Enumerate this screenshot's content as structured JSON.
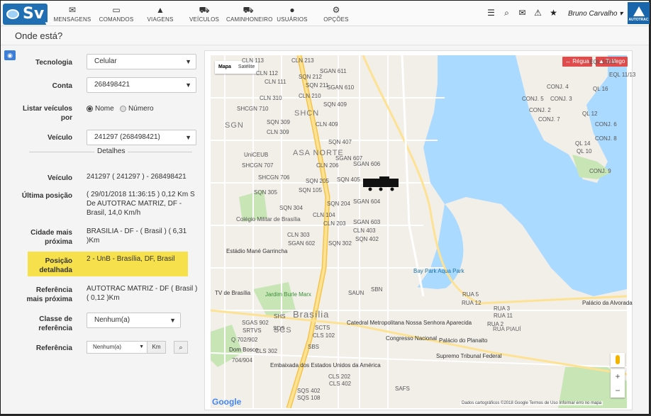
{
  "app": {
    "logo_text": "Sv",
    "logo_caret": "▼",
    "page_title": "Onde está?",
    "user_name": "Bruno Carvalho ▾",
    "brand_text": "AUTOTRAC"
  },
  "nav": [
    {
      "label": "MENSAGENS",
      "icon": "envelope-icon",
      "glyph": "✉"
    },
    {
      "label": "COMANDOS",
      "icon": "laptop-icon",
      "glyph": "▭"
    },
    {
      "label": "VIAGENS",
      "icon": "road-icon",
      "glyph": "▲"
    },
    {
      "label": "VEÍCULOS",
      "icon": "car-icon",
      "glyph": "⛟"
    },
    {
      "label": "CAMINHONEIRO",
      "icon": "truck-icon",
      "glyph": "⛟"
    },
    {
      "label": "USUÁRIOS",
      "icon": "user-icon",
      "glyph": "●"
    },
    {
      "label": "OPÇÕES",
      "icon": "cogs-icon",
      "glyph": "⚙"
    }
  ],
  "toolbar_icons": [
    {
      "name": "list-icon",
      "glyph": "☰"
    },
    {
      "name": "search-icon",
      "glyph": "⌕"
    },
    {
      "name": "mail-alert-icon",
      "glyph": "✉"
    },
    {
      "name": "warning-icon",
      "glyph": "⚠"
    },
    {
      "name": "star-icon",
      "glyph": "★"
    }
  ],
  "form": {
    "tecnologia": {
      "label": "Tecnologia",
      "value": "Celular"
    },
    "conta": {
      "label": "Conta",
      "value": "268498421"
    },
    "listar": {
      "label": "Listar veículos por",
      "opt1": "Nome",
      "opt2": "Número",
      "selected": "Nome"
    },
    "veiculo_sel": {
      "label": "Veículo",
      "value": "241297 (268498421)"
    },
    "section": "Detalhes",
    "veiculo": {
      "label": "Veículo",
      "value": "241297 ( 241297 ) - 268498421"
    },
    "ultima": {
      "label": "Última posição",
      "value": "( 29/01/2018 11:36:15 ) 0,12 Km S De AUTOTRAC MATRIZ, DF - Brasil, 14,0 Km/h"
    },
    "cidade": {
      "label": "Cidade mais próxima",
      "value": "BRASILIA - DF - ( Brasil ) ( 6,31 )Km"
    },
    "posicao": {
      "label": "Posição detalhada",
      "value": "2 - UnB - Brasília, DF, Brasil"
    },
    "referencia_prox": {
      "label": "Referência mais próxima",
      "value": "AUTOTRAC MATRIZ - DF ( Brasil ) ( 0,12 )Km"
    },
    "classe": {
      "label": "Classe de referência",
      "value": "Nenhum(a)"
    },
    "referencia": {
      "label": "Referência",
      "value": "Nenhum(a)",
      "unit": "Km"
    }
  },
  "map": {
    "types": [
      "Mapa",
      "Satélite"
    ],
    "regua": "↔ Régua",
    "trafego": "▲ Tráfego",
    "attribution": "Dados cartográficos ©2018 Google   Termos de Uso   Informar erro no mapa",
    "google": "Google",
    "zoom_in": "+",
    "zoom_out": "−",
    "place_big": [
      "ASA NORTE",
      "Brasília"
    ],
    "labels_grey": [
      "CLN 113",
      "CLN 213",
      "CLN 112",
      "SQN 212",
      "CLN 111",
      "SQN 211",
      "SGAN 611",
      "SGAN 610",
      "CLN 310",
      "CLN 210",
      "SQN 409",
      "SHCGN 710",
      "SHCN",
      "SQN 309",
      "SGN",
      "CLN 309",
      "CLN 409",
      "SQN 407",
      "UniCEUB",
      "SGAN 607",
      "SHCGN 707",
      "CLN 206",
      "SGAN 606",
      "SHCGN 706",
      "SQN 405",
      "SQN 305",
      "SQN 105",
      "SQN 205",
      "CLN 104",
      "SGAN 604",
      "SQN 304",
      "SQN 204",
      "SGAN 603",
      "CLN 303",
      "CLN 403",
      "CLN 203",
      "SQN 402",
      "SGAN 602",
      "SQN 302",
      "SGAS 902",
      "Q 702/902",
      "CLS 302",
      "704/904",
      "SQS 402",
      "CLS 402",
      "CLS 202",
      "SCTS",
      "SDS",
      "SAUN",
      "SBN",
      "SHS",
      "SRTVS",
      "SCS",
      "SBS",
      "SAFS",
      "EQL 10/11",
      "EQL 11/13",
      "CONJ. 4",
      "QL 16",
      "CONJ. 5",
      "CONJ. 3",
      "CONJ. 2",
      "CONJ. 7",
      "QL 12",
      "CONJ. 6",
      "CONJ. 8",
      "CONJ. 9",
      "QL 14",
      "QL 10",
      "RUA 5",
      "RUA 3",
      "RUA 2",
      "RUA 11",
      "RUA 12",
      "CLS 102",
      "SQS 108"
    ],
    "labels_poi": [
      "Colégio Militar de Brasília",
      "Estádio Mané Garrincha",
      "Bay Park Aqua Park",
      "TV de Brasília",
      "Jardim Burle Marx",
      "Catedral Metropolitana Nossa Senhora Aparecida",
      "Congresso Nacional",
      "Palácio do Planalto",
      "Supremo Tribunal Federal",
      "Embaixada dos Estados Unidos da América",
      "Palácio da Alvorada",
      "Dom Bosco",
      "RUA PIAUÍ"
    ]
  }
}
